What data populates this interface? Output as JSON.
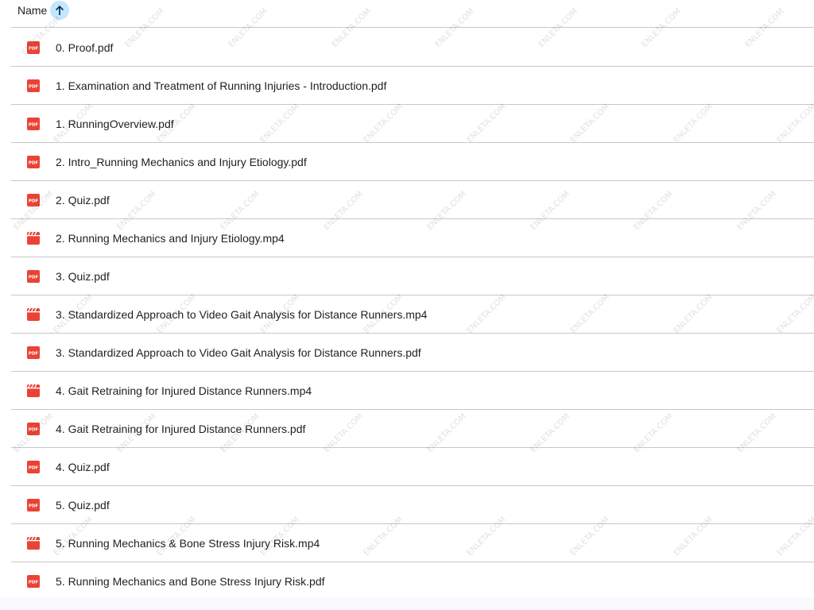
{
  "header": {
    "sort_label": "Name",
    "sort_icon": "arrow-up-icon",
    "sort_icon_bg": "#c2e7ff"
  },
  "watermark_text": "ENLETA.COM",
  "colors": {
    "pdf_icon": "#ea4335",
    "video_icon": "#ea4335",
    "divider": "#c7c7c7"
  },
  "files": [
    {
      "name": "0. Proof.pdf",
      "type": "pdf"
    },
    {
      "name": "1. Examination and Treatment of Running Injuries - Introduction.pdf",
      "type": "pdf"
    },
    {
      "name": "1. RunningOverview.pdf",
      "type": "pdf"
    },
    {
      "name": "2. Intro_Running Mechanics and Injury Etiology.pdf",
      "type": "pdf"
    },
    {
      "name": "2. Quiz.pdf",
      "type": "pdf"
    },
    {
      "name": "2. Running Mechanics and Injury Etiology.mp4",
      "type": "video"
    },
    {
      "name": "3. Quiz.pdf",
      "type": "pdf"
    },
    {
      "name": "3. Standardized Approach to Video Gait Analysis for Distance Runners.mp4",
      "type": "video"
    },
    {
      "name": "3. Standardized Approach to Video Gait Analysis for Distance Runners.pdf",
      "type": "pdf"
    },
    {
      "name": "4. Gait Retraining for Injured Distance Runners.mp4",
      "type": "video"
    },
    {
      "name": "4. Gait Retraining for Injured Distance Runners.pdf",
      "type": "pdf"
    },
    {
      "name": "4. Quiz.pdf",
      "type": "pdf"
    },
    {
      "name": "5. Quiz.pdf",
      "type": "pdf"
    },
    {
      "name": "5. Running Mechanics & Bone Stress Injury Risk.mp4",
      "type": "video"
    },
    {
      "name": "5. Running Mechanics and Bone Stress Injury Risk.pdf",
      "type": "pdf"
    }
  ]
}
